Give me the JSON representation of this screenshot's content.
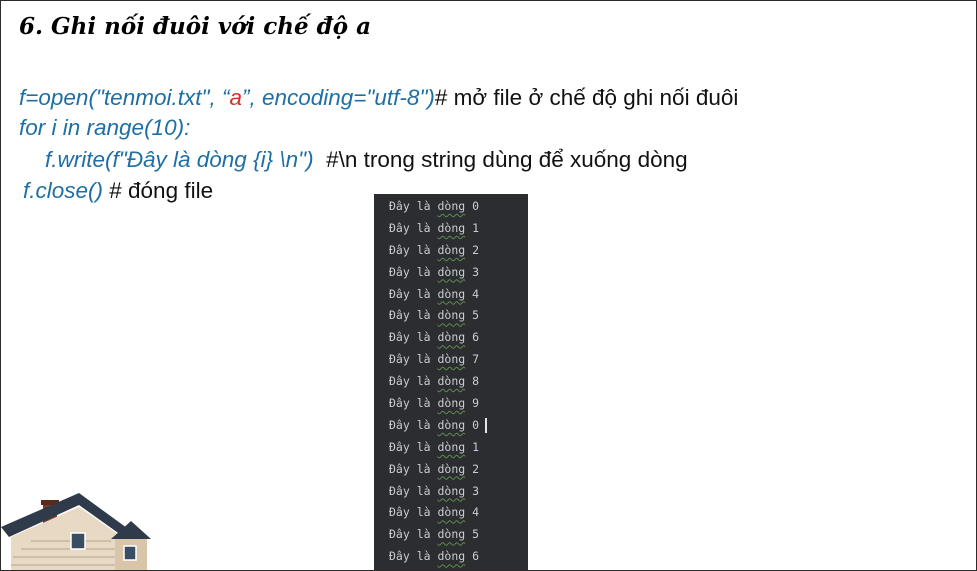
{
  "slide": {
    "title": "6. Ghi nối đuôi với chế độ a"
  },
  "code": {
    "line1": {
      "part1": "f=open(\"tenmoi.txt\", “",
      "mode": "a",
      "part2": "”, encoding=\"utf-8\")",
      "comment": "# mở file ở chế độ ghi nối đuôi"
    },
    "line2": {
      "text": "for i in range(10):"
    },
    "line3": {
      "code": "f.write(f\"Đây là dòng {i} \\n\")",
      "comment": "  #\\n trong string dùng để xuống dòng"
    },
    "line4": {
      "code": "f.close()",
      "comment": " # đóng file"
    }
  },
  "console": {
    "rows": [
      {
        "prefix": "Đây là ",
        "word": "dòng",
        "num": " 0"
      },
      {
        "prefix": "Đây là ",
        "word": "dòng",
        "num": " 1"
      },
      {
        "prefix": "Đây là ",
        "word": "dòng",
        "num": " 2"
      },
      {
        "prefix": "Đây là ",
        "word": "dòng",
        "num": " 3"
      },
      {
        "prefix": "Đây là ",
        "word": "dòng",
        "num": " 4"
      },
      {
        "prefix": "Đây là ",
        "word": "dòng",
        "num": " 5"
      },
      {
        "prefix": "Đây là ",
        "word": "dòng",
        "num": " 6"
      },
      {
        "prefix": "Đây là ",
        "word": "dòng",
        "num": " 7"
      },
      {
        "prefix": "Đây là ",
        "word": "dòng",
        "num": " 8"
      },
      {
        "prefix": "Đây là ",
        "word": "dòng",
        "num": " 9"
      },
      {
        "prefix": "Đây là ",
        "word": "dòng",
        "num": " 0"
      },
      {
        "prefix": "Đây là ",
        "word": "dòng",
        "num": " 1"
      },
      {
        "prefix": "Đây là ",
        "word": "dòng",
        "num": " 2"
      },
      {
        "prefix": "Đây là ",
        "word": "dòng",
        "num": " 3"
      },
      {
        "prefix": "Đây là ",
        "word": "dòng",
        "num": " 4"
      },
      {
        "prefix": "Đây là ",
        "word": "dòng",
        "num": " 5"
      },
      {
        "prefix": "Đây là ",
        "word": "dòng",
        "num": " 6"
      }
    ],
    "cursor_row": 10
  },
  "decor": {
    "icon": "house-illustration-icon"
  },
  "colors": {
    "code": "#1f6fa3",
    "mode_highlight": "#d9302a",
    "console_bg": "#2b2d30",
    "console_text": "#c9cdd2"
  }
}
